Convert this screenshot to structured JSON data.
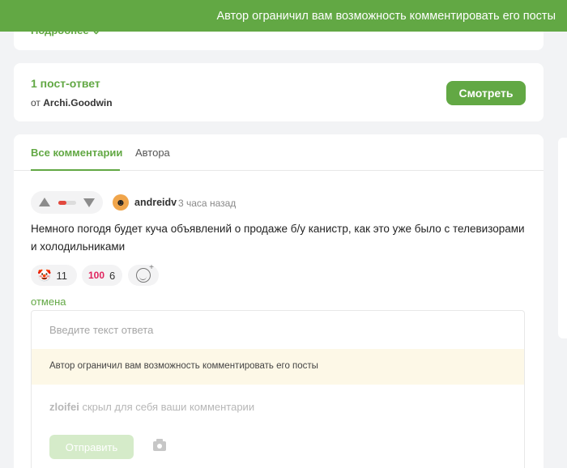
{
  "toast": {
    "message": "Автор ограничил вам возможность комментировать его посты"
  },
  "top_card": {
    "more_label": "Подробнее ⌄"
  },
  "answers_card": {
    "title": "1 пост-ответ",
    "from_prefix": "от",
    "from_user": "Archi.Goodwin",
    "view_button": "Смотреть"
  },
  "tabs": [
    {
      "label": "Все комментарии",
      "active": true
    },
    {
      "label": "Автора",
      "active": false
    }
  ],
  "comment": {
    "author": "andreidv",
    "time": "3 часа назад",
    "rating_fraction": 0.45,
    "text": "Немного погодя будет куча объявлений о продаже б/у канистр, как это уже было с телевизорами и холодильниками",
    "reactions": [
      {
        "icon": "clown-face-icon",
        "glyph": "🤡",
        "count": "11"
      },
      {
        "icon": "hundred-points-icon",
        "glyph": "100",
        "count": "6"
      }
    ],
    "cancel_label": "отмена"
  },
  "reply": {
    "placeholder": "Введите текст ответа",
    "notice": "Автор ограничил вам возможность комментировать его посты",
    "hidden_user": "zloifei",
    "hidden_text": "скрыл для себя ваши комментарии",
    "send_label": "Отправить"
  },
  "colors": {
    "accent": "#62a844",
    "notice_bg": "#fdf8e7",
    "downvote": "#e2483d"
  }
}
